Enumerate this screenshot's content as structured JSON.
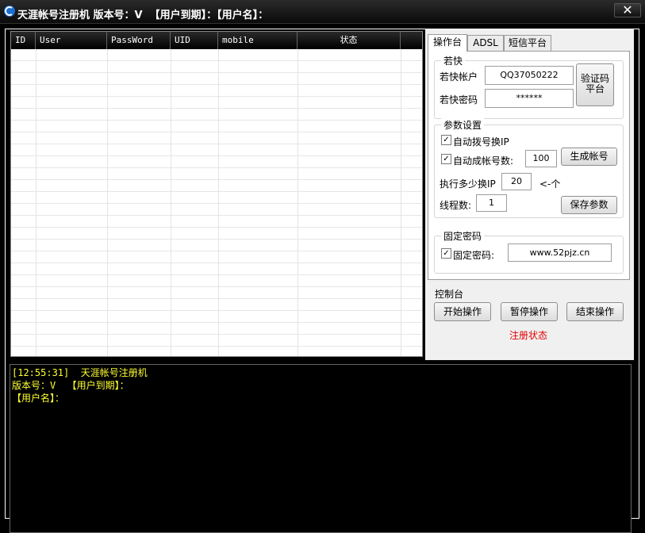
{
  "window": {
    "title": "天涯帐号注册机 版本号：V  【用户到期】：【用户名】：",
    "close_label": "✕"
  },
  "grid": {
    "columns": [
      "ID",
      "User",
      "PassWord",
      "UID",
      "mobile",
      "状态"
    ],
    "rows": []
  },
  "tabs": [
    {
      "label": "操作台",
      "active": true
    },
    {
      "label": "ADSL",
      "active": false
    },
    {
      "label": "短信平台",
      "active": false
    }
  ],
  "ruokuai": {
    "title": "若快",
    "account_label": "若快帐户",
    "account_value": "QQ37050222",
    "password_label": "若快密码",
    "password_value": "******",
    "captcha_button": "验证码平台"
  },
  "params": {
    "title": "参数设置",
    "auto_dial_label": "自动拨号换IP",
    "auto_dial_checked": true,
    "auto_gen_label": "自动成帐号数:",
    "auto_gen_checked": true,
    "auto_gen_value": "100",
    "generate_button": "生成帐号",
    "switch_ip_label": "执行多少换IP",
    "switch_ip_value": "20",
    "switch_ip_suffix": "<-个",
    "threads_label": "线程数:",
    "threads_value": "1",
    "save_button": "保存参数"
  },
  "fixed_password": {
    "title": "固定密码",
    "label": "固定密码:",
    "checked": true,
    "value": "www.52pjz.cn"
  },
  "console": {
    "title": "控制台",
    "start_button": "开始操作",
    "pause_button": "暂停操作",
    "stop_button": "结束操作",
    "status": "注册状态"
  },
  "log": {
    "lines": [
      "[12:55:31]  天涯帐号注册机",
      "版本号：V  【用户到期】：",
      "【用户名】："
    ]
  },
  "colors": {
    "log_text": "#ffff33",
    "status_text": "#e00000",
    "titlebar": "#111111"
  }
}
